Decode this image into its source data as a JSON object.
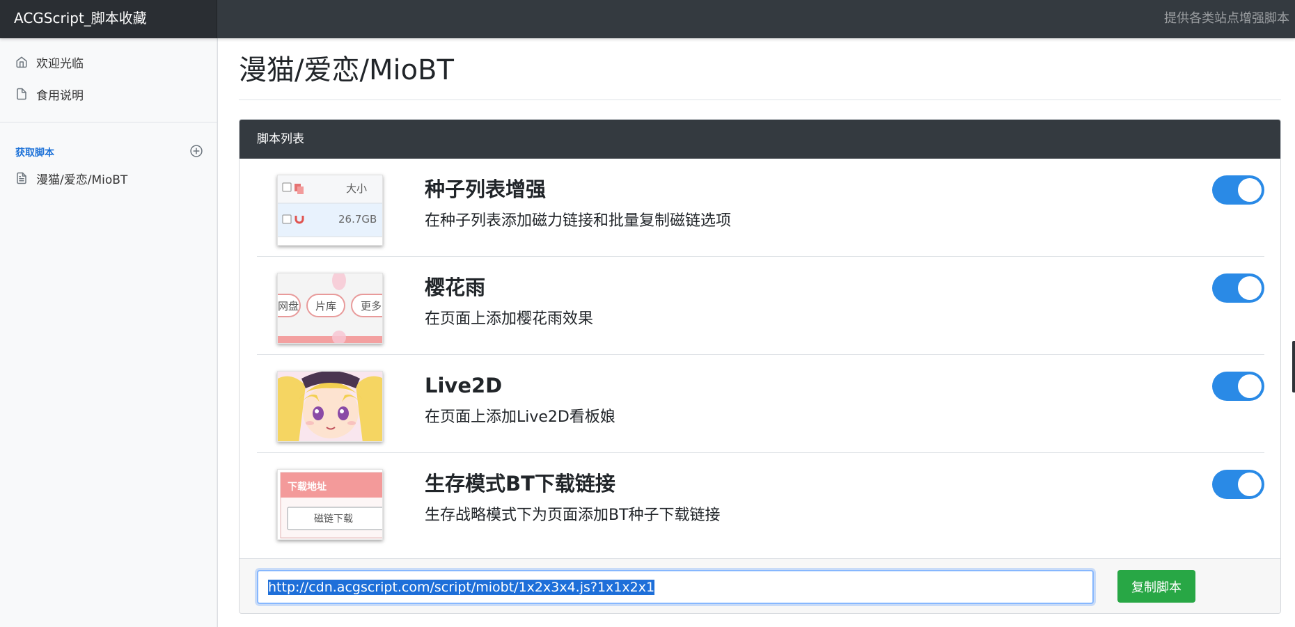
{
  "navbar": {
    "brand": "ACGScript_脚本收藏",
    "tagline": "提供各类站点增强脚本"
  },
  "sidebar": {
    "links": [
      {
        "label": "欢迎光临",
        "icon": "home-icon"
      },
      {
        "label": "食用说明",
        "icon": "file-icon"
      }
    ],
    "section_heading": "获取脚本",
    "section_action_icon": "plus-circle-icon",
    "section_links": [
      {
        "label": "漫猫/爱恋/MioBT",
        "icon": "file-text-icon"
      }
    ]
  },
  "main": {
    "title": "漫猫/爱恋/MioBT",
    "card_header": "脚本列表",
    "scripts": [
      {
        "name": "种子列表增强",
        "desc": "在种子列表添加磁力链接和批量复制磁链选项",
        "enabled": true,
        "thumb": {
          "header": "大小",
          "size": "26.7GB"
        }
      },
      {
        "name": "樱花雨",
        "desc": "在页面上添加樱花雨效果",
        "enabled": true,
        "thumb": {
          "tab1": "网盘",
          "tab2": "片库",
          "tab3": "更多"
        }
      },
      {
        "name": "Live2D",
        "desc": "在页面上添加Live2D看板娘",
        "enabled": true,
        "thumb": {}
      },
      {
        "name": "生存模式BT下载链接",
        "desc": "生存战略模式下为页面添加BT种子下载链接",
        "enabled": true,
        "thumb": {
          "header": "下载地址",
          "button": "磁链下载"
        }
      }
    ],
    "footer": {
      "script_url": "http://cdn.acgscript.com/script/miobt/1x2x3x4.js?1x1x2x1",
      "copy_label": "复制脚本"
    }
  },
  "colors": {
    "navbar": "#343a40",
    "accent": "#2a8ae6",
    "copy_button": "#28a745",
    "sidebar_heading": "#1d72d8"
  }
}
